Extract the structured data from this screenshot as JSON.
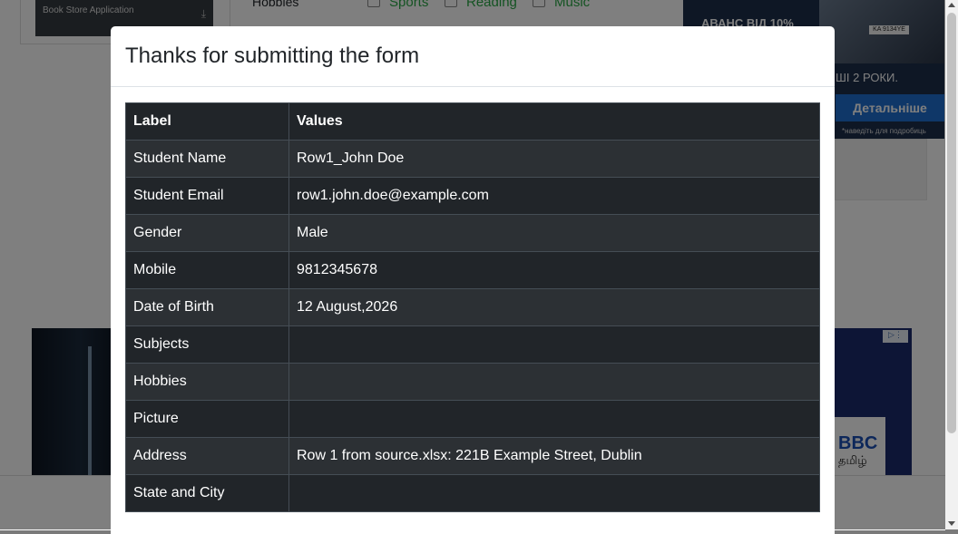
{
  "background": {
    "app_item_label": "Book Store Application",
    "hobbies_label": "Hobbies",
    "hobbies_options": [
      "Sports",
      "Reading",
      "Music"
    ],
    "ad_top": {
      "headline": "АВАНС ВІД 10%",
      "plate": "KA 9134YE",
      "subline": "ШІ 2 РОКИ.",
      "button": "Детальніше",
      "footnote": "*наведіть для подробиць"
    },
    "ad_bottom_right": {
      "brand": "BBC",
      "script": "தமிழ்"
    }
  },
  "modal": {
    "title": "Thanks for submitting the form",
    "headers": {
      "label": "Label",
      "values": "Values"
    },
    "rows": [
      {
        "label": "Student Name",
        "value": "Row1_John Doe"
      },
      {
        "label": "Student Email",
        "value": "row1.john.doe@example.com"
      },
      {
        "label": "Gender",
        "value": "Male"
      },
      {
        "label": "Mobile",
        "value": "9812345678"
      },
      {
        "label": "Date of Birth",
        "value": "12 August,2026"
      },
      {
        "label": "Subjects",
        "value": ""
      },
      {
        "label": "Hobbies",
        "value": ""
      },
      {
        "label": "Picture",
        "value": ""
      },
      {
        "label": "Address",
        "value": "Row 1 from source.xlsx: 221B Example Street, Dublin"
      },
      {
        "label": "State and City",
        "value": ""
      }
    ]
  }
}
